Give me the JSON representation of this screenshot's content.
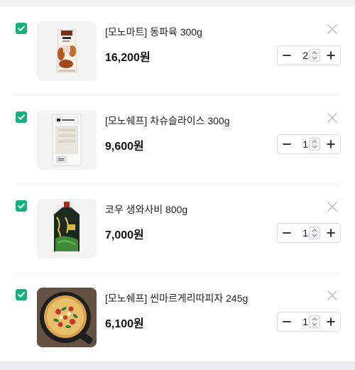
{
  "cart": {
    "items": [
      {
        "checked": true,
        "name": "[모노마트] 동파육 300g",
        "price": "16,200원",
        "quantity": "2",
        "image": "dongpayuk-package"
      },
      {
        "checked": true,
        "name": "[모노쉐프] 차슈슬라이스 300g",
        "price": "9,600원",
        "quantity": "1",
        "image": "chashu-package"
      },
      {
        "checked": true,
        "name": "코우 생와사비 800g",
        "price": "7,000원",
        "quantity": "1",
        "image": "wasabi-pouch"
      },
      {
        "checked": true,
        "name": "[모노쉐프] 씬마르게리따피자 245g",
        "price": "6,100원",
        "quantity": "1",
        "image": "margherita-pizza"
      }
    ]
  },
  "colors": {
    "checkbox": "#13b27c",
    "remove_icon": "#c4c4c4",
    "border": "#dcdcdc"
  },
  "icons": {
    "check": "check-icon",
    "remove": "close-icon",
    "minus": "minus-icon",
    "plus": "plus-icon",
    "spin": "spin-arrows-icon"
  }
}
